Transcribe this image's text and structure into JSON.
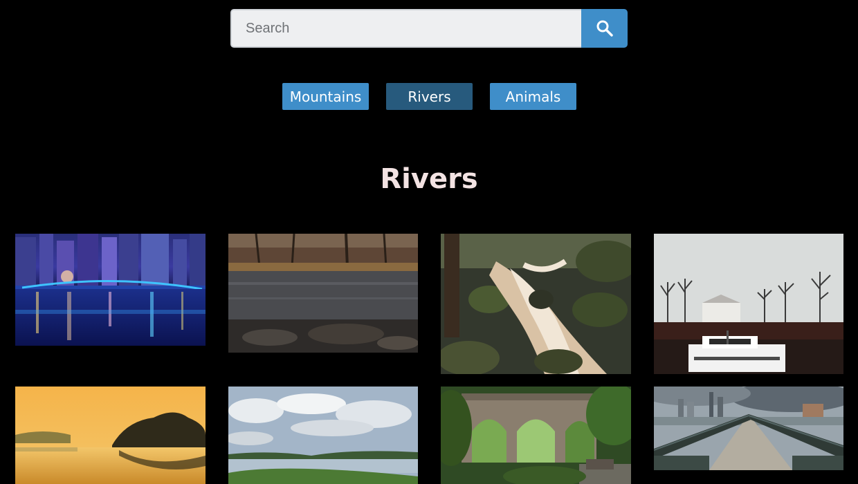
{
  "search": {
    "placeholder": "Search",
    "value": "",
    "button_icon": "search-icon"
  },
  "categories": [
    {
      "label": "Mountains",
      "active": false
    },
    {
      "label": "Rivers",
      "active": true
    },
    {
      "label": "Animals",
      "active": false
    }
  ],
  "section": {
    "title": "Rivers"
  },
  "photos": [
    {
      "subject": "city skyline with lit bridge reflected in river at night"
    },
    {
      "subject": "forest river bank in autumn"
    },
    {
      "subject": "waterfall cascading over mossy rocks"
    },
    {
      "subject": "white boat on river with bare trees and house"
    },
    {
      "subject": "golden sunrise over calm river with tree island"
    },
    {
      "subject": "wide river under cloudy sky with green banks"
    },
    {
      "subject": "stone arch viaduct over wooded gorge"
    },
    {
      "subject": "pedestrian bridge leading to city skyline"
    }
  ],
  "colors": {
    "background": "#000000",
    "accent": "#3f8ec9",
    "accent_active": "#275a7d",
    "title": "#f3e3e3"
  }
}
